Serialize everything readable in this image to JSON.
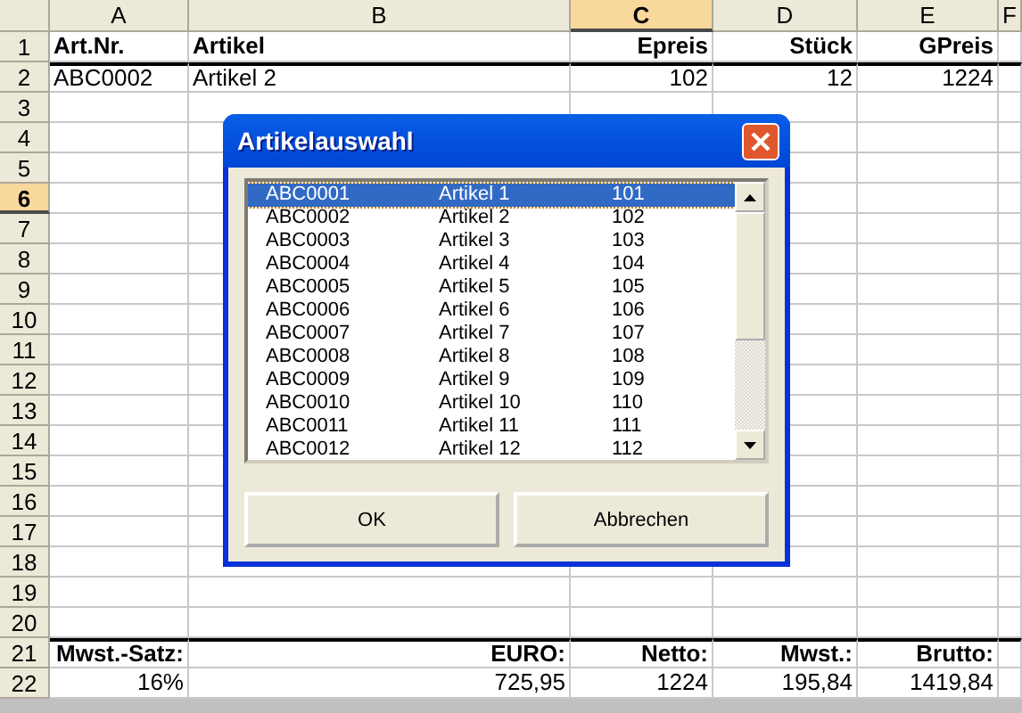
{
  "sheet": {
    "columns": [
      {
        "label": "A",
        "selected": false
      },
      {
        "label": "B",
        "selected": false
      },
      {
        "label": "C",
        "selected": true
      },
      {
        "label": "D",
        "selected": false
      },
      {
        "label": "E",
        "selected": false
      },
      {
        "label": "F",
        "selected": false
      }
    ],
    "rows": [
      {
        "header": "1",
        "selected": false,
        "ruled_above": false,
        "cells": [
          {
            "text": "Art.Nr.",
            "kind": "heading_left"
          },
          {
            "text": "Artikel",
            "kind": "heading_left"
          },
          {
            "text": "Epreis",
            "kind": "heading"
          },
          {
            "text": "Stück",
            "kind": "heading"
          },
          {
            "text": "GPreis",
            "kind": "heading"
          }
        ]
      },
      {
        "header": "2",
        "selected": false,
        "ruled_above": true,
        "cells": [
          {
            "text": "ABC0002",
            "kind": "text"
          },
          {
            "text": "Artikel 2",
            "kind": "text"
          },
          {
            "text": "102",
            "kind": "number"
          },
          {
            "text": "12",
            "kind": "number"
          },
          {
            "text": "1224",
            "kind": "number"
          }
        ]
      },
      {
        "header": "3",
        "selected": false,
        "ruled_above": false
      },
      {
        "header": "4",
        "selected": false,
        "ruled_above": false
      },
      {
        "header": "5",
        "selected": false,
        "ruled_above": false
      },
      {
        "header": "6",
        "selected": true,
        "ruled_above": false
      },
      {
        "header": "7",
        "selected": false,
        "ruled_above": false
      },
      {
        "header": "8",
        "selected": false,
        "ruled_above": false
      },
      {
        "header": "9",
        "selected": false,
        "ruled_above": false
      },
      {
        "header": "10",
        "selected": false,
        "ruled_above": false
      },
      {
        "header": "11",
        "selected": false,
        "ruled_above": false
      },
      {
        "header": "12",
        "selected": false,
        "ruled_above": false
      },
      {
        "header": "13",
        "selected": false,
        "ruled_above": false
      },
      {
        "header": "14",
        "selected": false,
        "ruled_above": false
      },
      {
        "header": "15",
        "selected": false,
        "ruled_above": false
      },
      {
        "header": "16",
        "selected": false,
        "ruled_above": false
      },
      {
        "header": "17",
        "selected": false,
        "ruled_above": false
      },
      {
        "header": "18",
        "selected": false,
        "ruled_above": false
      },
      {
        "header": "19",
        "selected": false,
        "ruled_above": false
      },
      {
        "header": "20",
        "selected": false,
        "ruled_above": false
      },
      {
        "header": "21",
        "selected": false,
        "ruled_above": true,
        "cells": [
          {
            "text": "Mwst.-Satz:",
            "kind": "heading"
          },
          {
            "text": "EURO:",
            "kind": "heading"
          },
          {
            "text": "Netto:",
            "kind": "heading"
          },
          {
            "text": "Mwst.:",
            "kind": "heading"
          },
          {
            "text": "Brutto:",
            "kind": "heading"
          }
        ]
      },
      {
        "header": "22",
        "selected": false,
        "ruled_above": false,
        "cells": [
          {
            "text": "16%",
            "kind": "number"
          },
          {
            "text": "725,95",
            "kind": "number"
          },
          {
            "text": "1224",
            "kind": "number"
          },
          {
            "text": "195,84",
            "kind": "number"
          },
          {
            "text": "1419,84",
            "kind": "number"
          }
        ]
      }
    ]
  },
  "dialog": {
    "title": "Artikelauswahl",
    "items": [
      {
        "code": "ABC0001",
        "name": "Artikel 1",
        "price": "101",
        "selected": true
      },
      {
        "code": "ABC0002",
        "name": "Artikel 2",
        "price": "102",
        "selected": false
      },
      {
        "code": "ABC0003",
        "name": "Artikel 3",
        "price": "103",
        "selected": false
      },
      {
        "code": "ABC0004",
        "name": "Artikel 4",
        "price": "104",
        "selected": false
      },
      {
        "code": "ABC0005",
        "name": "Artikel 5",
        "price": "105",
        "selected": false
      },
      {
        "code": "ABC0006",
        "name": "Artikel 6",
        "price": "106",
        "selected": false
      },
      {
        "code": "ABC0007",
        "name": "Artikel 7",
        "price": "107",
        "selected": false
      },
      {
        "code": "ABC0008",
        "name": "Artikel 8",
        "price": "108",
        "selected": false
      },
      {
        "code": "ABC0009",
        "name": "Artikel 9",
        "price": "109",
        "selected": false
      },
      {
        "code": "ABC0010",
        "name": "Artikel 10",
        "price": "110",
        "selected": false
      },
      {
        "code": "ABC0011",
        "name": "Artikel 11",
        "price": "111",
        "selected": false
      },
      {
        "code": "ABC0012",
        "name": "Artikel 12",
        "price": "112",
        "selected": false
      }
    ],
    "buttons": [
      "OK",
      "Abbrechen"
    ]
  }
}
